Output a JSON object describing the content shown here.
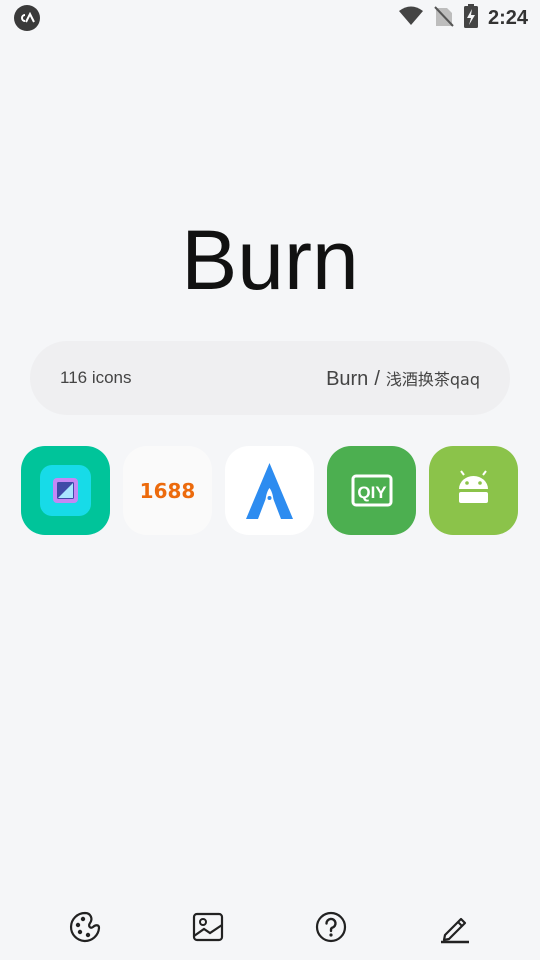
{
  "status_bar": {
    "time": "2:24",
    "icons": [
      "app-logo-icon",
      "wifi-icon",
      "no-sim-icon",
      "battery-charging-icon"
    ]
  },
  "title": "Burn",
  "info": {
    "icon_count": "116 icons",
    "author_name": "Burn",
    "separator": "/",
    "author_credit": "浅酒换茶qaq"
  },
  "apps": [
    {
      "name": "gallery-app-icon",
      "bg": "#00c49a"
    },
    {
      "name": "1688-app-icon",
      "label": "1688",
      "bg": "#fafafa",
      "color": "#ec6a0c"
    },
    {
      "name": "rocket-a-app-icon",
      "bg": "#ffffff",
      "color": "#2d8cf0"
    },
    {
      "name": "iqiyi-app-icon",
      "label": "iQIYI",
      "bg": "#4caf50"
    },
    {
      "name": "android-app-icon",
      "bg": "#8bc34a"
    }
  ],
  "bottom_nav": [
    "palette-icon",
    "wallpaper-icon",
    "help-icon",
    "edit-icon"
  ],
  "colors": {
    "background": "#f5f6f8",
    "pill": "#efeff1",
    "text": "#444444"
  }
}
